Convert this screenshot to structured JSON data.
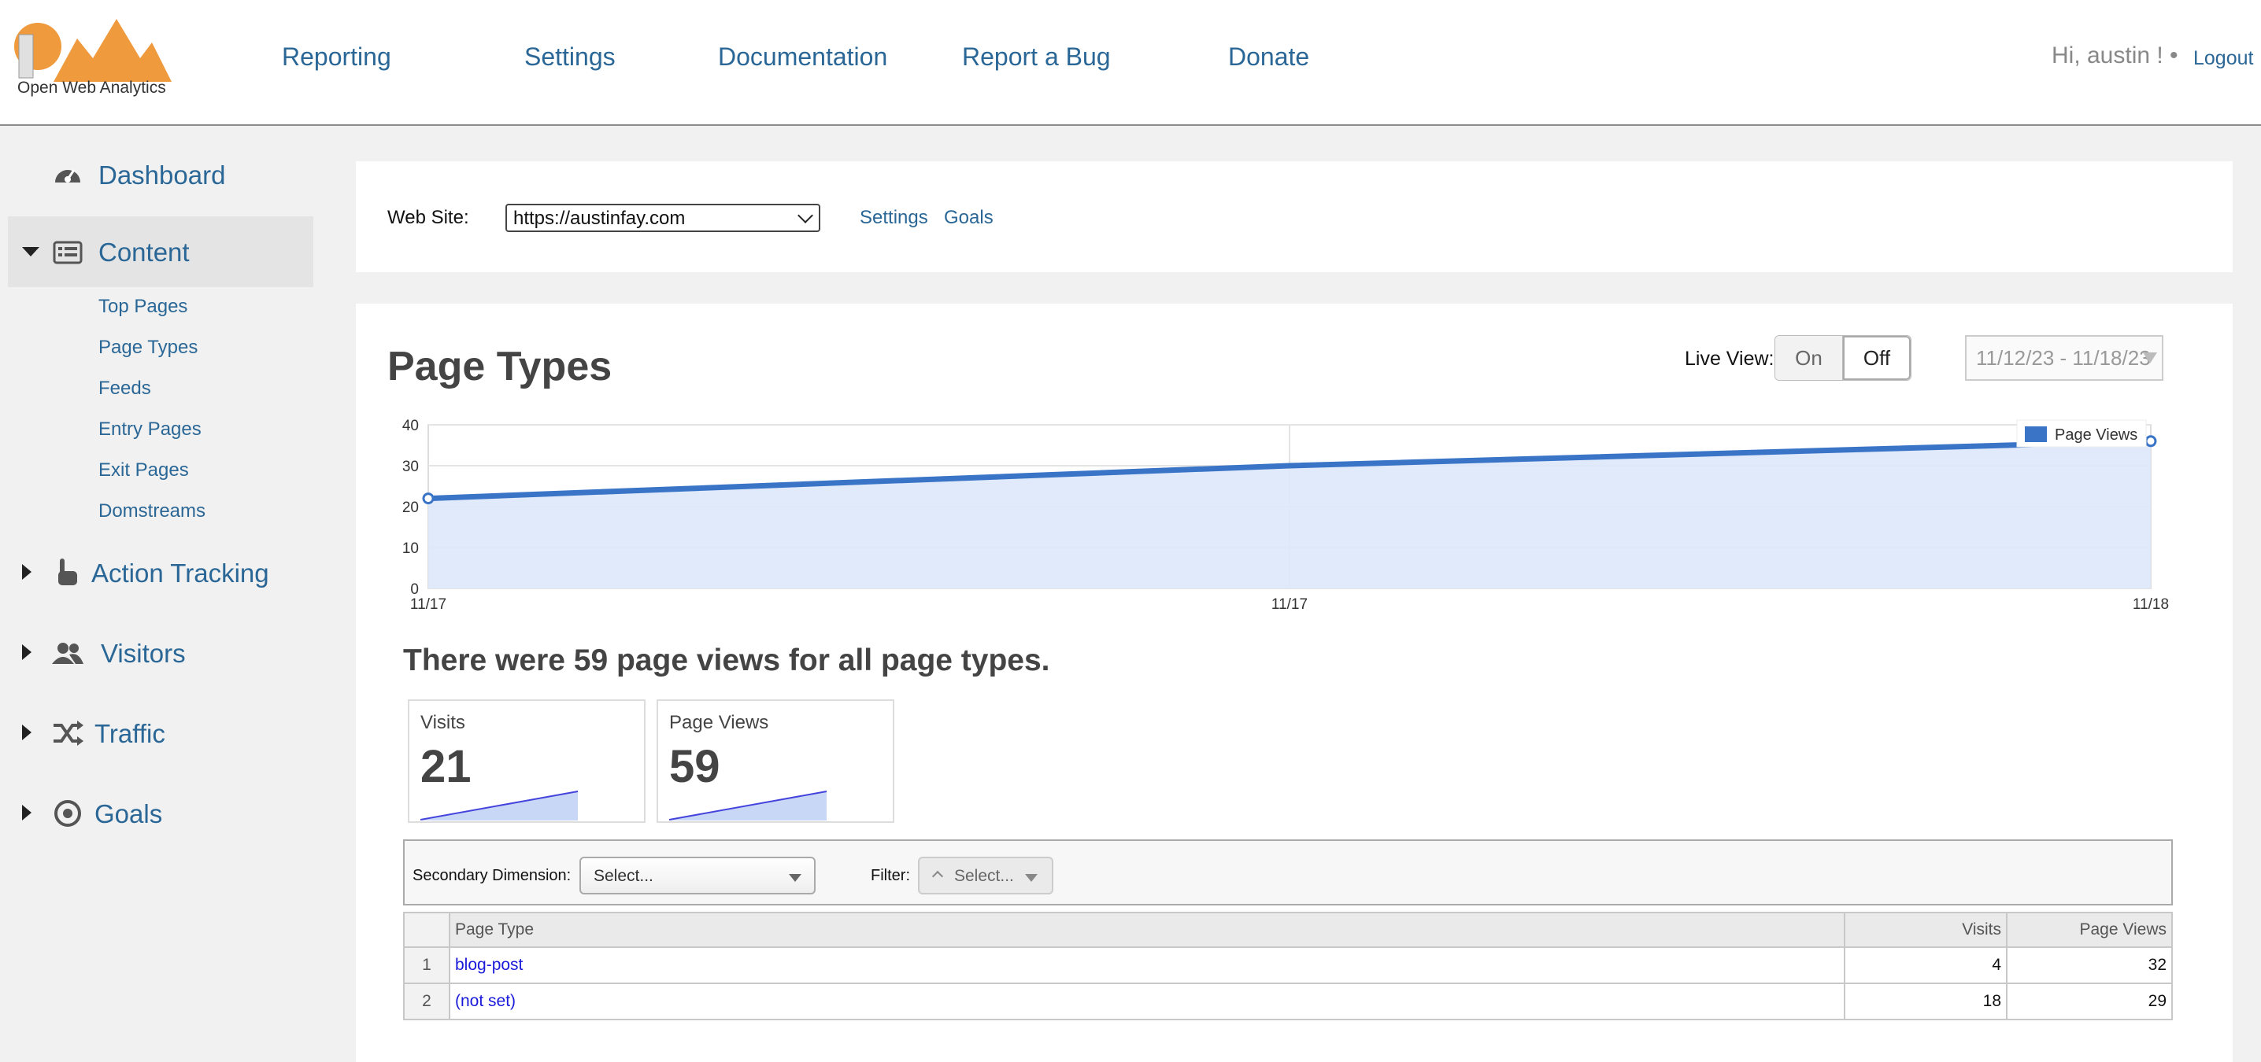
{
  "header": {
    "logo_text": "Open Web Analytics",
    "nav": [
      "Reporting",
      "Settings",
      "Documentation",
      "Report a Bug",
      "Donate"
    ],
    "greeting": "Hi, austin ! •",
    "logout": "Logout"
  },
  "sidebar": {
    "items": [
      {
        "label": "Dashboard",
        "icon": "dashboard-icon"
      },
      {
        "label": "Content",
        "icon": "content-list-icon",
        "expanded": true
      },
      {
        "label": "Action Tracking",
        "icon": "pointer-hand-icon"
      },
      {
        "label": "Visitors",
        "icon": "users-icon"
      },
      {
        "label": "Traffic",
        "icon": "shuffle-icon"
      },
      {
        "label": "Goals",
        "icon": "target-icon"
      }
    ],
    "content_sub": [
      "Top Pages",
      "Page Types",
      "Feeds",
      "Entry Pages",
      "Exit Pages",
      "Domstreams"
    ]
  },
  "site_panel": {
    "label": "Web Site:",
    "selected_site": "https://austinfay.com",
    "settings_link": "Settings",
    "goals_link": "Goals"
  },
  "main": {
    "title": "Page Types",
    "live_view_label": "Live View:",
    "live_on": "On",
    "live_off": "Off",
    "live_state": "Off",
    "date_range": "11/12/23 - 11/18/23",
    "summary": "There were 59 page views for all page types.",
    "metrics": [
      {
        "label": "Visits",
        "value": "21"
      },
      {
        "label": "Page Views",
        "value": "59"
      }
    ],
    "filter": {
      "secondary_label": "Secondary Dimension:",
      "secondary_placeholder": "Select...",
      "filter_label": "Filter:",
      "filter_placeholder": "Select..."
    },
    "table": {
      "columns": [
        "Page Type",
        "Visits",
        "Page Views"
      ],
      "rows": [
        {
          "idx": "1",
          "page_type": "blog-post",
          "visits": "4",
          "page_views": "32"
        },
        {
          "idx": "2",
          "page_type": "(not set)",
          "visits": "18",
          "page_views": "29"
        }
      ]
    }
  },
  "colors": {
    "link": "#2a6796",
    "chart_line": "#3a74c7",
    "chart_fill": "#dde8fb",
    "logo_orange": "#ef9a3c"
  },
  "chart_data": {
    "type": "area",
    "x": [
      "11/17",
      "11/17",
      "11/18"
    ],
    "series": [
      {
        "name": "Page Views",
        "values": [
          22,
          30,
          36
        ]
      }
    ],
    "yticks": [
      0,
      10,
      20,
      30,
      40
    ],
    "ylim": [
      0,
      40
    ],
    "legend": "top-right",
    "grid": true
  }
}
